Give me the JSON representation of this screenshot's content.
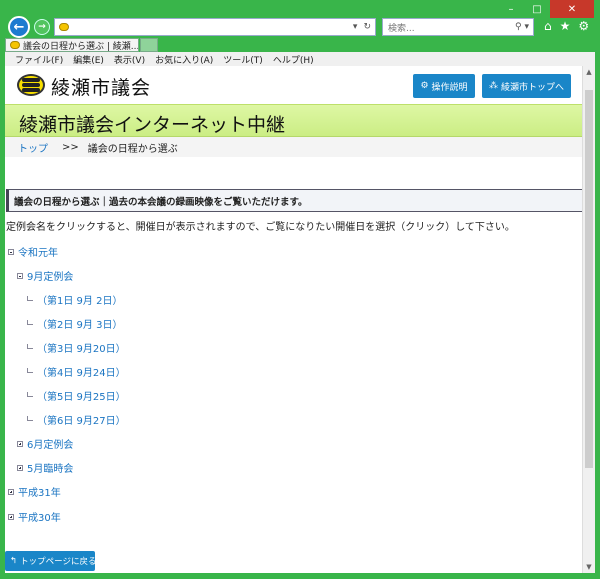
{
  "browser": {
    "address_value": "",
    "search_placeholder": "検索...",
    "tab_title": "議会の日程から選ぶ | 綾瀬...",
    "tab_close": "×",
    "menu": [
      "ファイル(F)",
      "編集(E)",
      "表示(V)",
      "お気に入り(A)",
      "ツール(T)",
      "ヘルプ(H)"
    ]
  },
  "header": {
    "site_name": "綾瀬市議会",
    "btn_help": "操作説明",
    "btn_city_top": "綾瀬市トップへ"
  },
  "banner": {
    "title": "綾瀬市議会インターネット中継"
  },
  "breadcrumb": {
    "home": "トップ",
    "separator": ">>",
    "current": "議会の日程から選ぶ"
  },
  "lead": "議会の日程から選ぶ｜過去の本会議の録画映像をご覧いただけます。",
  "description": "定例会名をクリックすると、開催日が表示されますので、ご覧になりたい開催日を選択（クリック）して下さい。",
  "tree": {
    "year1": "令和元年",
    "session_sep": "9月定例会",
    "days": [
      "（第1日 9月 2日）",
      "（第2日 9月 3日）",
      "（第3日 9月20日）",
      "（第4日 9月24日）",
      "（第5日 9月25日）",
      "（第6日 9月27日）"
    ],
    "session_jun": "6月定例会",
    "session_may": "5月臨時会",
    "year2": "平成31年",
    "year3": "平成30年"
  },
  "footer": {
    "back_to_top": "トップページに戻る"
  },
  "colors": {
    "frame": "#39b54a",
    "accent": "#1a86c8",
    "banner": "#cbed84",
    "link": "#1a74c2"
  }
}
